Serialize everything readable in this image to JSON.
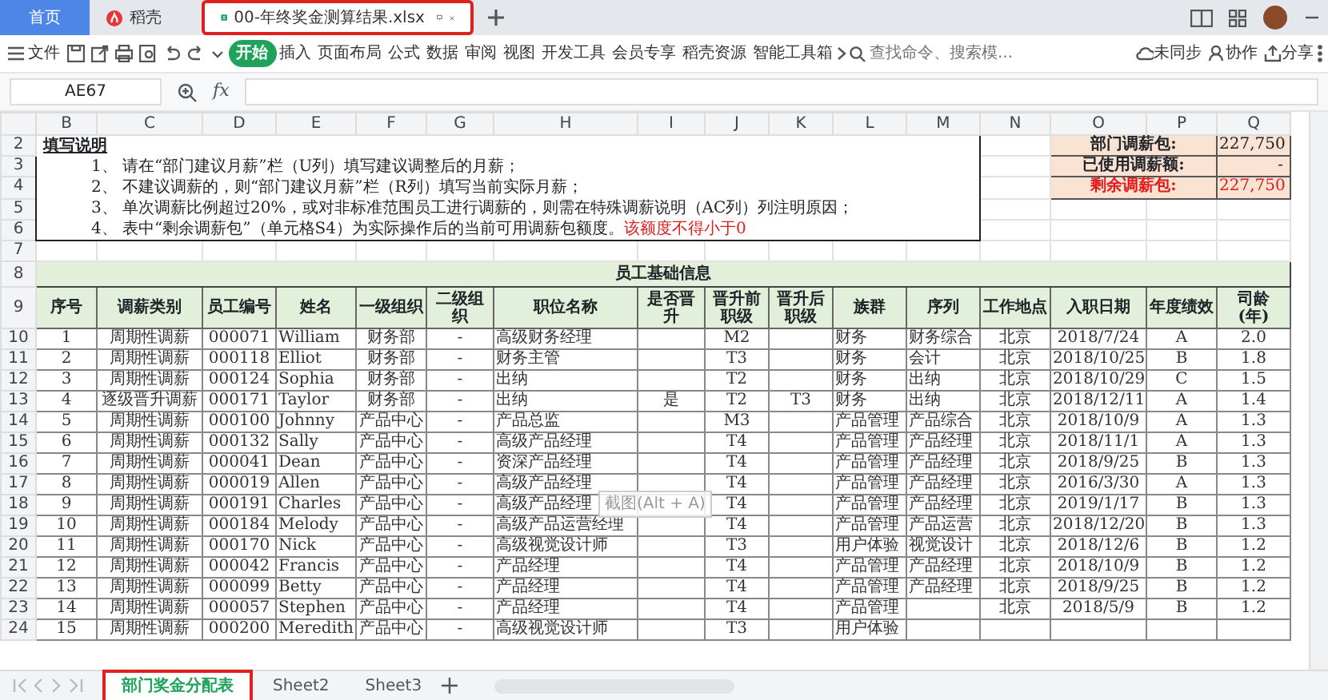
{
  "window_tabs": [
    {
      "label": "首页",
      "kind": "home",
      "selected": false
    },
    {
      "label": "稻壳",
      "kind": "docer",
      "selected": false
    },
    {
      "label": "00-年终奖金测算结果.xlsx",
      "kind": "file",
      "selected": true
    }
  ],
  "toolbar": {
    "file_menu": "文件",
    "ribbon_tabs": [
      {
        "label": "开始",
        "selected": true
      },
      {
        "label": "插入",
        "selected": false
      },
      {
        "label": "页面布局",
        "selected": false
      },
      {
        "label": "公式",
        "selected": false
      },
      {
        "label": "数据",
        "selected": false
      },
      {
        "label": "审阅",
        "selected": false
      },
      {
        "label": "视图",
        "selected": false
      },
      {
        "label": "开发工具",
        "selected": false
      },
      {
        "label": "会员专享",
        "selected": false
      },
      {
        "label": "稻壳资源",
        "selected": false
      },
      {
        "label": "智能工具箱",
        "selected": false
      }
    ],
    "search": {
      "placeholder": "查找命令、搜索模..."
    },
    "actions": [
      "未同步",
      "协作",
      "分享"
    ]
  },
  "formula_bar": {
    "cell_ref": "AE67",
    "fx": "fx"
  },
  "columns": [
    "B",
    "C",
    "D",
    "E",
    "F",
    "G",
    "H",
    "I",
    "J",
    "K",
    "L",
    "M",
    "N",
    "O",
    "P",
    "Q"
  ],
  "instructions": {
    "row_numbers": [
      "2",
      "3",
      "4",
      "5",
      "6"
    ],
    "title": "填写说明",
    "lines": [
      {
        "text": "1、 请在“部门建议月薪”栏（U列）填写建议调整后的月薪；"
      },
      {
        "text": "2、 不建议调薪的，则“部门建议月薪”栏（R列）填写当前实际月薪；"
      },
      {
        "text": "3、 单次调薪比例超过20%，或对非标准范围员工进行调薪的，则需在特殊调薪说明（AC列）列注明原因；"
      },
      {
        "text": "4、 表中“剩余调薪包”（单元格S4）为实际操作后的当前可用调薪包额度。",
        "note": "该额度不得小于0"
      }
    ]
  },
  "summary": [
    {
      "label": "部门调薪包:",
      "value": "227,750",
      "alert": false
    },
    {
      "label": "已使用调薪额:",
      "value": "-",
      "alert": false
    },
    {
      "label": "剩余调薪包:",
      "value": "227,750",
      "alert": true
    }
  ],
  "empty_row_number": "7",
  "table": {
    "title_row_number": "8",
    "title": "员工基础信息",
    "header_row_number": "9",
    "headers": [
      "序号",
      "调薪类别",
      "员工编号",
      "姓名",
      "一级组织",
      "二级组织",
      "职位名称",
      "是否晋升",
      "晋升前职级",
      "晋升后职级",
      "族群",
      "序列",
      "工作地点",
      "入职日期",
      "年度绩效",
      "司龄\n(年)"
    ],
    "rows": [
      {
        "row_number": "10",
        "cells": [
          "1",
          "周期性调薪",
          "000071",
          "William",
          "财务部",
          "-",
          "高级财务经理",
          null,
          "M2",
          null,
          "财务",
          "财务综合",
          "北京",
          "2018/7/24",
          "A",
          "2.0"
        ]
      },
      {
        "row_number": "11",
        "cells": [
          "2",
          "周期性调薪",
          "000118",
          "Elliot",
          "财务部",
          "-",
          "财务主管",
          null,
          "T3",
          null,
          "财务",
          "会计",
          "北京",
          "2018/10/25",
          "B",
          "1.8"
        ]
      },
      {
        "row_number": "12",
        "cells": [
          "3",
          "周期性调薪",
          "000124",
          "Sophia",
          "财务部",
          "-",
          "出纳",
          null,
          "T2",
          null,
          "财务",
          "出纳",
          "北京",
          "2018/10/29",
          "C",
          "1.5"
        ]
      },
      {
        "row_number": "13",
        "cells": [
          "4",
          "逐级晋升调薪",
          "000171",
          "Taylor",
          "财务部",
          "-",
          "出纳",
          "是",
          "T2",
          "T3",
          "财务",
          "出纳",
          "北京",
          "2018/12/11",
          "A",
          "1.4"
        ]
      },
      {
        "row_number": "14",
        "cells": [
          "5",
          "周期性调薪",
          "000100",
          "Johnny",
          "产品中心",
          "-",
          "产品总监",
          null,
          "M3",
          null,
          "产品管理",
          "产品综合",
          "北京",
          "2018/10/9",
          "A",
          "1.3"
        ]
      },
      {
        "row_number": "15",
        "cells": [
          "6",
          "周期性调薪",
          "000132",
          "Sally",
          "产品中心",
          "-",
          "高级产品经理",
          null,
          "T4",
          null,
          "产品管理",
          "产品经理",
          "北京",
          "2018/11/1",
          "A",
          "1.3"
        ]
      },
      {
        "row_number": "16",
        "cells": [
          "7",
          "周期性调薪",
          "000041",
          "Dean",
          "产品中心",
          "-",
          "资深产品经理",
          null,
          "T4",
          null,
          "产品管理",
          "产品经理",
          "北京",
          "2018/9/25",
          "B",
          "1.3"
        ]
      },
      {
        "row_number": "17",
        "cells": [
          "8",
          "周期性调薪",
          "000019",
          "Allen",
          "产品中心",
          "-",
          "高级产品经理",
          null,
          "T4",
          null,
          "产品管理",
          "产品经理",
          "北京",
          "2016/3/30",
          "A",
          "1.3"
        ]
      },
      {
        "row_number": "18",
        "cells": [
          "9",
          "周期性调薪",
          "000191",
          "Charles",
          "产品中心",
          "-",
          "高级产品经理",
          null,
          "T4",
          null,
          "产品管理",
          "产品经理",
          "北京",
          "2019/1/17",
          "B",
          "1.3"
        ]
      },
      {
        "row_number": "19",
        "cells": [
          "10",
          "周期性调薪",
          "000184",
          "Melody",
          "产品中心",
          "-",
          "高级产品运营经理",
          null,
          "T4",
          null,
          "产品管理",
          "产品运营",
          "北京",
          "2018/12/20",
          "B",
          "1.3"
        ]
      },
      {
        "row_number": "20",
        "cells": [
          "11",
          "周期性调薪",
          "000170",
          "Nick",
          "产品中心",
          "-",
          "高级视觉设计师",
          null,
          "T3",
          null,
          "用户体验",
          "视觉设计",
          "北京",
          "2018/12/6",
          "B",
          "1.2"
        ]
      },
      {
        "row_number": "21",
        "cells": [
          "12",
          "周期性调薪",
          "000042",
          "Francis",
          "产品中心",
          "-",
          "产品经理",
          null,
          "T4",
          null,
          "产品管理",
          "产品经理",
          "北京",
          "2018/10/9",
          "B",
          "1.2"
        ]
      },
      {
        "row_number": "22",
        "cells": [
          "13",
          "周期性调薪",
          "000099",
          "Betty",
          "产品中心",
          "-",
          "产品经理",
          null,
          "T4",
          null,
          "产品管理",
          "产品经理",
          "北京",
          "2018/9/25",
          "B",
          "1.2"
        ]
      },
      {
        "row_number": "23",
        "cells": [
          "14",
          "周期性调薪",
          "000057",
          "Stephen",
          "产品中心",
          "-",
          "产品经理",
          null,
          "T4",
          null,
          "产品管理",
          null,
          "北京",
          "2018/5/9",
          "B",
          "1.2"
        ]
      },
      {
        "row_number": "24",
        "cells": [
          "15",
          "周期性调薪",
          "000200",
          "Meredith",
          "产品中心",
          "-",
          "高级视觉设计师",
          null,
          "T3",
          null,
          "用户体验",
          null,
          null,
          null,
          null,
          null
        ]
      }
    ]
  },
  "tooltip": "截图(Alt + A)",
  "sheet_tabs": [
    {
      "label": "部门奖金分配表",
      "selected": true
    },
    {
      "label": "Sheet2",
      "selected": false
    },
    {
      "label": "Sheet3",
      "selected": false
    }
  ]
}
